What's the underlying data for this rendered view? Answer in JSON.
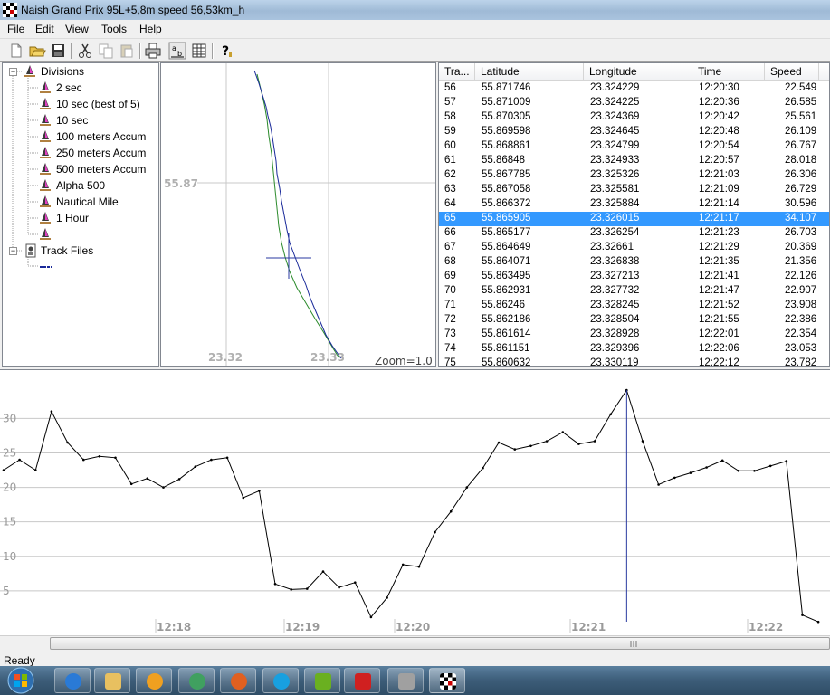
{
  "window": {
    "title": "Naish Grand Prix 95L+5,8m speed 56,53km_h"
  },
  "menu": {
    "file": "File",
    "edit": "Edit",
    "view": "View",
    "tools": "Tools",
    "help": "Help"
  },
  "tree": {
    "divisions_label": "Divisions",
    "items": [
      "2 sec",
      "10 sec (best of 5)",
      "10 sec",
      "100 meters Accum",
      "250 meters Accum",
      "500 meters Accum",
      "Alpha 500",
      "Nautical Mile",
      "1 Hour"
    ],
    "track_files_label": "Track Files"
  },
  "map": {
    "lat_label": "55.87",
    "lon_labels": [
      "23.32",
      "23.33"
    ],
    "zoom_label": "Zoom=1.0"
  },
  "table": {
    "headers": [
      "Tra...",
      "Latitude",
      "Longitude",
      "Time",
      "Speed"
    ],
    "selected_index": 9,
    "rows": [
      [
        "56",
        "55.871746",
        "23.324229",
        "12:20:30",
        "22.549"
      ],
      [
        "57",
        "55.871009",
        "23.324225",
        "12:20:36",
        "26.585"
      ],
      [
        "58",
        "55.870305",
        "23.324369",
        "12:20:42",
        "25.561"
      ],
      [
        "59",
        "55.869598",
        "23.324645",
        "12:20:48",
        "26.109"
      ],
      [
        "60",
        "55.868861",
        "23.324799",
        "12:20:54",
        "26.767"
      ],
      [
        "61",
        "55.86848",
        "23.324933",
        "12:20:57",
        "28.018"
      ],
      [
        "62",
        "55.867785",
        "23.325326",
        "12:21:03",
        "26.306"
      ],
      [
        "63",
        "55.867058",
        "23.325581",
        "12:21:09",
        "26.729"
      ],
      [
        "64",
        "55.866372",
        "23.325884",
        "12:21:14",
        "30.596"
      ],
      [
        "65",
        "55.865905",
        "23.326015",
        "12:21:17",
        "34.107"
      ],
      [
        "66",
        "55.865177",
        "23.326254",
        "12:21:23",
        "26.703"
      ],
      [
        "67",
        "55.864649",
        "23.32661",
        "12:21:29",
        "20.369"
      ],
      [
        "68",
        "55.864071",
        "23.326838",
        "12:21:35",
        "21.356"
      ],
      [
        "69",
        "55.863495",
        "23.327213",
        "12:21:41",
        "22.126"
      ],
      [
        "70",
        "55.862931",
        "23.327732",
        "12:21:47",
        "22.907"
      ],
      [
        "71",
        "55.86246",
        "23.328245",
        "12:21:52",
        "23.908"
      ],
      [
        "72",
        "55.862186",
        "23.328504",
        "12:21:55",
        "22.386"
      ],
      [
        "73",
        "55.861614",
        "23.328928",
        "12:22:01",
        "22.354"
      ],
      [
        "74",
        "55.861151",
        "23.329396",
        "12:22:06",
        "23.053"
      ],
      [
        "75",
        "55.860632",
        "23.330119",
        "12:22:12",
        "23.782"
      ]
    ]
  },
  "speed_chart": {
    "y_ticks": [
      "30",
      "25",
      "20",
      "15",
      "10",
      "5"
    ],
    "x_ticks": [
      "12:18",
      "12:19",
      "12:20",
      "12:21",
      "12:22"
    ],
    "values": [
      22.5,
      24,
      22.5,
      31,
      26.5,
      24,
      24.5,
      24.3,
      20.5,
      21.3,
      20,
      21.2,
      23,
      24,
      24.3,
      18.5,
      19.5,
      6,
      5.2,
      5.3,
      7.8,
      5.5,
      6.2,
      1.2,
      4,
      8.8,
      8.5,
      13.5,
      16.5,
      20,
      22.8,
      26.5,
      25.5,
      26,
      26.7,
      28,
      26.3,
      26.7,
      30.6,
      34.1,
      26.7,
      20.4,
      21.4,
      22.1,
      22.9,
      23.9,
      22.4,
      22.4,
      23.1,
      23.8,
      1.5,
      0.5
    ],
    "cursor_index": 39
  },
  "status": {
    "text": "Ready"
  },
  "colors": {
    "selection": "#3399ff",
    "track_blue": "#1a2a9a",
    "track_green": "#2a8a2a"
  }
}
